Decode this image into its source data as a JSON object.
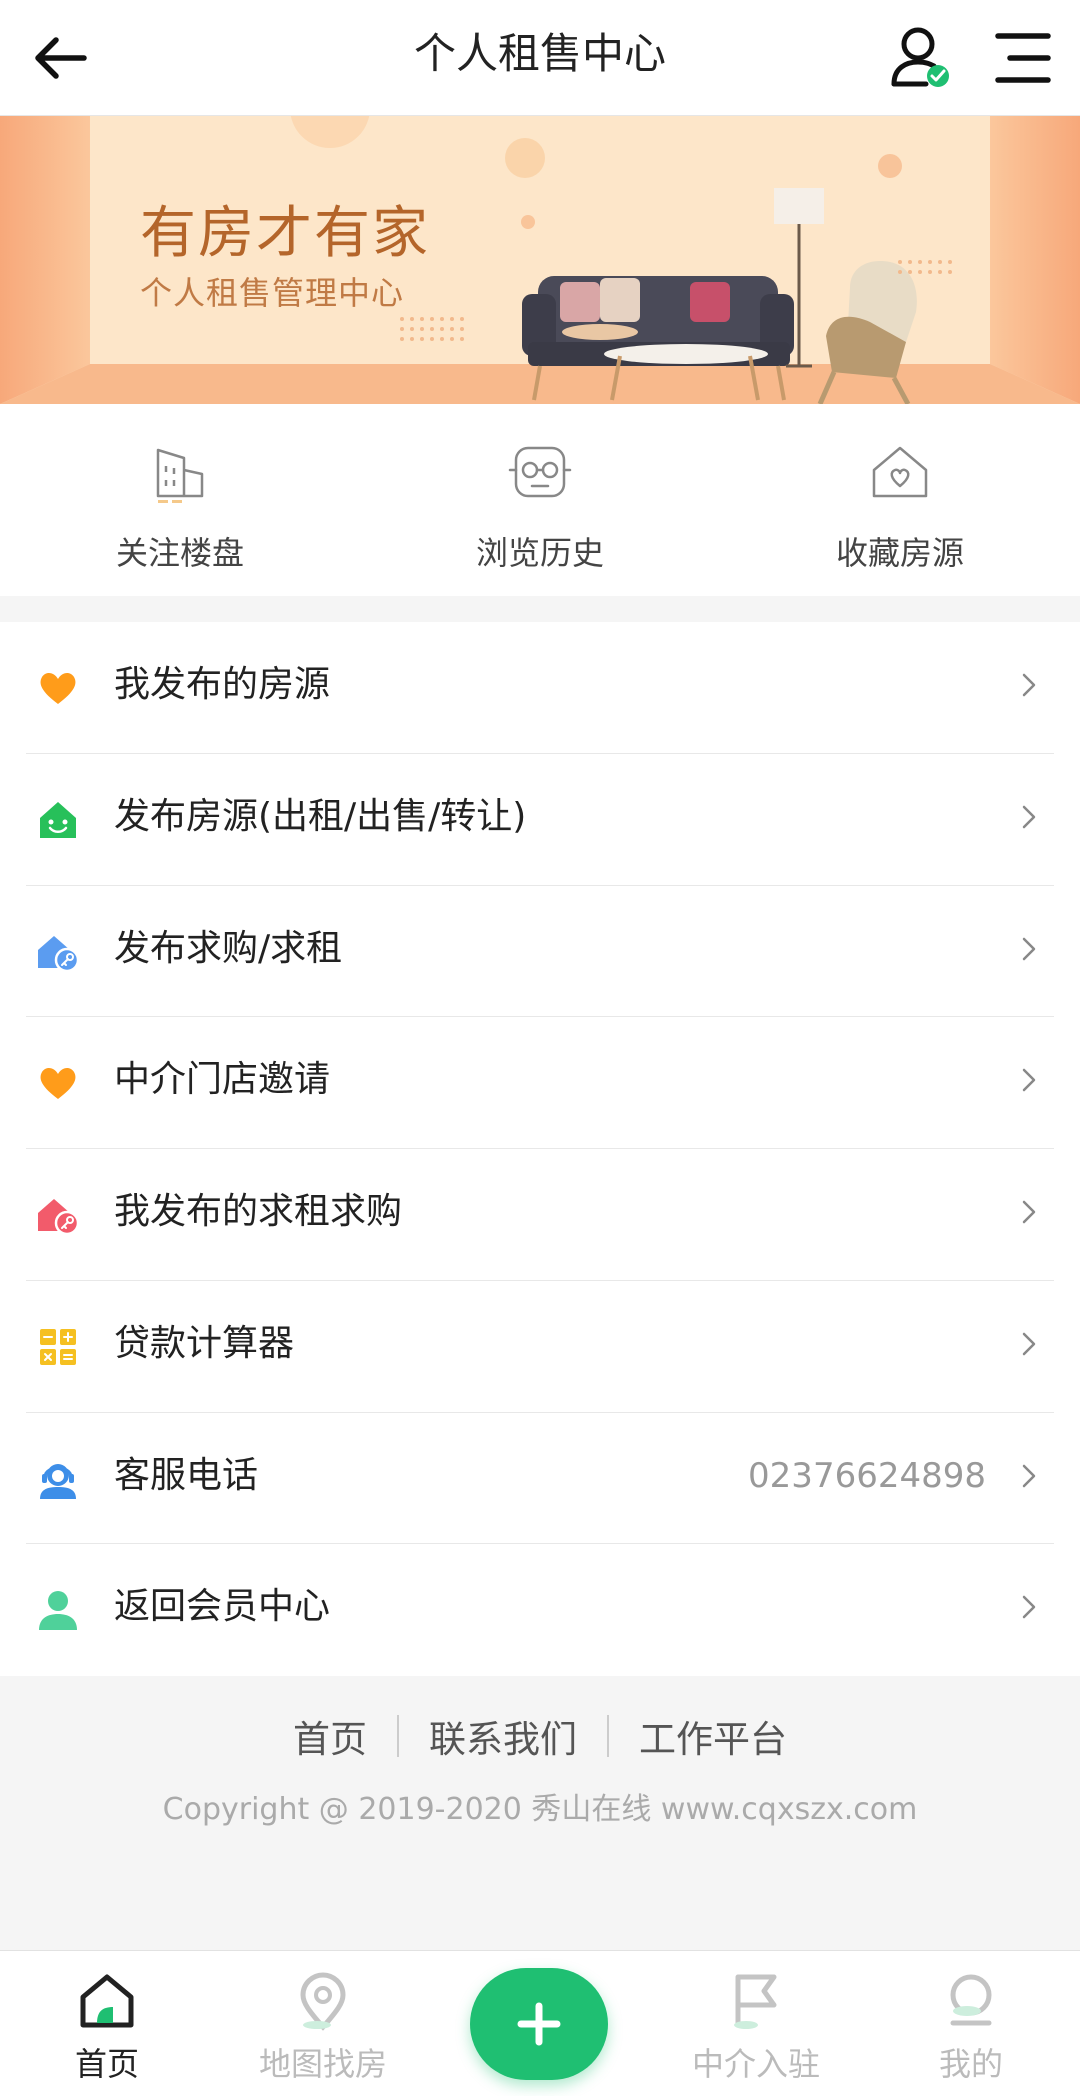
{
  "header": {
    "title": "个人租售中心",
    "back_icon": "arrow-left-icon",
    "user_icon": "user-verified-icon",
    "menu_icon": "hamburger-menu-icon"
  },
  "banner": {
    "title": "有房才有家",
    "subtitle": "个人租售管理中心"
  },
  "shortcuts": [
    {
      "label": "关注楼盘",
      "icon": "building-icon"
    },
    {
      "label": "浏览历史",
      "icon": "glasses-face-icon"
    },
    {
      "label": "收藏房源",
      "icon": "house-heart-icon"
    }
  ],
  "menu": [
    {
      "label": "我发布的房源",
      "icon": "heart-icon",
      "color": "#ff9c1a"
    },
    {
      "label": "发布房源(出租/出售/转让)",
      "icon": "house-smile-icon",
      "color": "#27c05a"
    },
    {
      "label": "发布求购/求租",
      "icon": "house-key-icon",
      "color": "#5b9cf0"
    },
    {
      "label": "中介门店邀请",
      "icon": "heart-icon",
      "color": "#ff9c1a"
    },
    {
      "label": "我发布的求租求购",
      "icon": "house-key-icon",
      "color": "#f25b6b"
    },
    {
      "label": "贷款计算器",
      "icon": "calculator-icon",
      "color": "#f5c021"
    },
    {
      "label": "客服电话",
      "icon": "customer-service-icon",
      "color": "#3d8ee8",
      "value": "02376624898"
    },
    {
      "label": "返回会员中心",
      "icon": "member-icon",
      "color": "#4fd19a"
    }
  ],
  "footer": {
    "links": [
      "首页",
      "联系我们",
      "工作平台"
    ],
    "copyright": "Copyright @ 2019-2020 秀山在线 www.cqxszx.com"
  },
  "tabbar": {
    "tabs": [
      {
        "label": "首页",
        "icon": "home-icon",
        "active": true
      },
      {
        "label": "地图找房",
        "icon": "map-pin-icon",
        "active": false
      },
      {
        "label": "中介入驻",
        "icon": "flag-icon",
        "active": false
      },
      {
        "label": "我的",
        "icon": "profile-icon",
        "active": false
      }
    ],
    "fab_icon": "plus-icon",
    "accent": "#1fbf72"
  }
}
